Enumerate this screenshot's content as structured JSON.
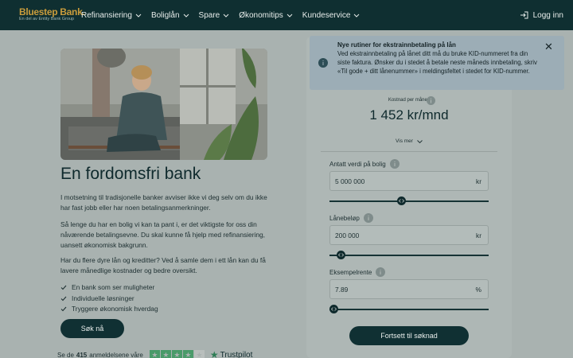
{
  "brand": {
    "name": "Bluestep Bank.",
    "tagline": "En del av Entity Bank Group"
  },
  "nav": {
    "items": [
      {
        "label": "Refinansiering"
      },
      {
        "label": "Boliglån"
      },
      {
        "label": "Spare"
      },
      {
        "label": "Økonomitips"
      },
      {
        "label": "Kundeservice"
      }
    ],
    "login": "Logg inn"
  },
  "hero": {
    "title": "En fordomsfri bank",
    "paragraphs": [
      "I motsetning til tradisjonelle banker avviser ikke vi deg selv om du ikke har fast jobb eller har noen betalingsanmerkninger.",
      "Så lenge du har en bolig vi kan ta pant i, er det viktigste for oss din nåværende betalingsevne. Du skal kunne få hjelp med refinansiering, uansett økonomisk bakgrunn.",
      "Har du flere dyre lån og kreditter? Ved å samle dem i ett lån kan du få lavere månedlige kostnader og bedre oversikt."
    ],
    "checklist": [
      "En bank som ser muligheter",
      "Individuelle løsninger",
      "Tryggere økonomisk hverdag"
    ],
    "apply_label": "Søk nå",
    "trust": {
      "prefix": "Se de",
      "count": "415",
      "suffix": "anmeldelsene våre",
      "brand": "Trustpilot",
      "rating_stars": 4
    }
  },
  "notice": {
    "title": "Nye rutiner for ekstrainnbetaling på lån",
    "body": "Ved ekstrainnbetaling på lånet ditt må du bruke KID-nummeret fra din siste faktura. Ønsker du i stedet å betale neste måneds innbetaling, skriv «Til gode + ditt lånenummer» i meldingsfeltet i stedet for KID-nummer."
  },
  "calculator": {
    "cost_label": "Kostnad per måned",
    "cost_value": "1 452 kr/mnd",
    "show_more": "Vis mer",
    "fields": [
      {
        "label": "Antatt verdi på bolig",
        "value": "5 000 000",
        "unit": "kr",
        "slider_fraction": 0.45
      },
      {
        "label": "Lånebeløp",
        "value": "200 000",
        "unit": "kr",
        "slider_fraction": 0.05
      },
      {
        "label": "Eksempelrente",
        "value": "7.89",
        "unit": "%",
        "slider_fraction": 0.0
      }
    ],
    "continue_label": "Fortsett til søknad"
  },
  "colors": {
    "header": "#0f2f31",
    "logo": "#c99c3c",
    "button": "#103033",
    "overlay": "#a9b2b0"
  }
}
